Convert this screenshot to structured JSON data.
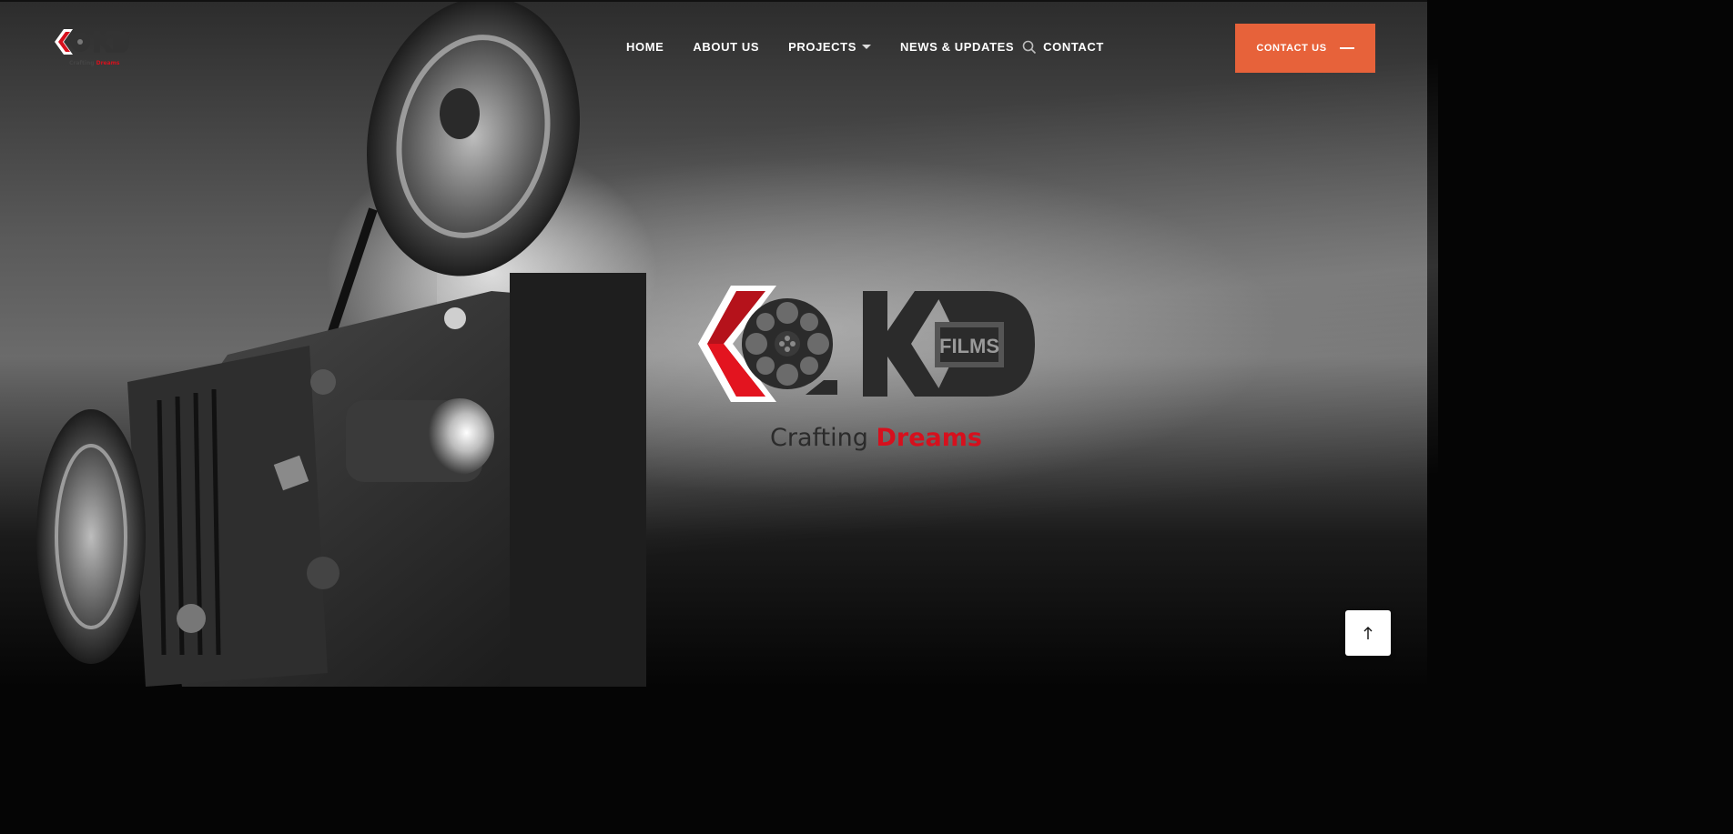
{
  "brand": {
    "name": "KD Films",
    "tagline_prefix": "Crafting",
    "tagline_accent": "Dreams",
    "logo_text": "FILMS",
    "colors": {
      "red": "#d6101d",
      "dark": "#2b2b2b"
    }
  },
  "nav": {
    "items": [
      {
        "label": "HOME"
      },
      {
        "label": "ABOUT US"
      },
      {
        "label": "PROJECTS",
        "has_dropdown": true
      },
      {
        "label": "NEWS & UPDATES"
      },
      {
        "label": "CONTACT"
      }
    ],
    "search_icon": "search-icon"
  },
  "cta": {
    "label": "CONTACT US",
    "color": "#e7623a"
  },
  "hero": {
    "tagline_prefix": "Crafting",
    "tagline_accent": "Dreams"
  },
  "scroll_top": {
    "icon": "arrow-up-icon"
  }
}
